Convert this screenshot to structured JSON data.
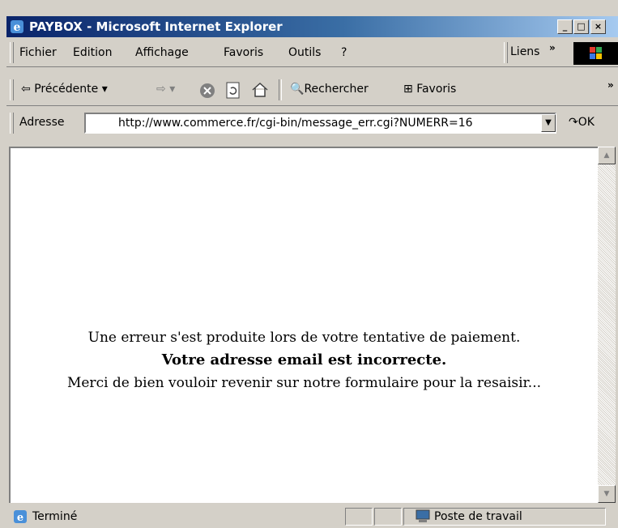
{
  "window": {
    "title": "PAYBOX - Microsoft Internet Explorer",
    "minimize": "_",
    "maximize": "□",
    "close": "×"
  },
  "menu": {
    "items": [
      "Fichier",
      "Edition",
      "Affichage",
      "Favoris",
      "Outils",
      "?"
    ],
    "links_label": "Liens",
    "chevron": "»"
  },
  "toolbar": {
    "back_label": "Précédente",
    "search_label": "Rechercher",
    "favorites_label": "Favoris",
    "chevron": "»"
  },
  "address": {
    "label": "Adresse",
    "url": "http://www.commerce.fr/cgi-bin/message_err.cgi?NUMERR=16",
    "go_label": "OK"
  },
  "content": {
    "line1": "Une erreur s'est produite lors de votre tentative de paiement.",
    "line2": "Votre adresse email est incorrecte.",
    "line3": "Merci de bien vouloir revenir sur notre formulaire pour la resaisir..."
  },
  "status": {
    "text": "Terminé",
    "zone": "Poste de travail"
  },
  "colors": {
    "title_gradient_start": "#0a246a",
    "title_gradient_end": "#a6caf0",
    "chrome": "#d4d0c8"
  }
}
